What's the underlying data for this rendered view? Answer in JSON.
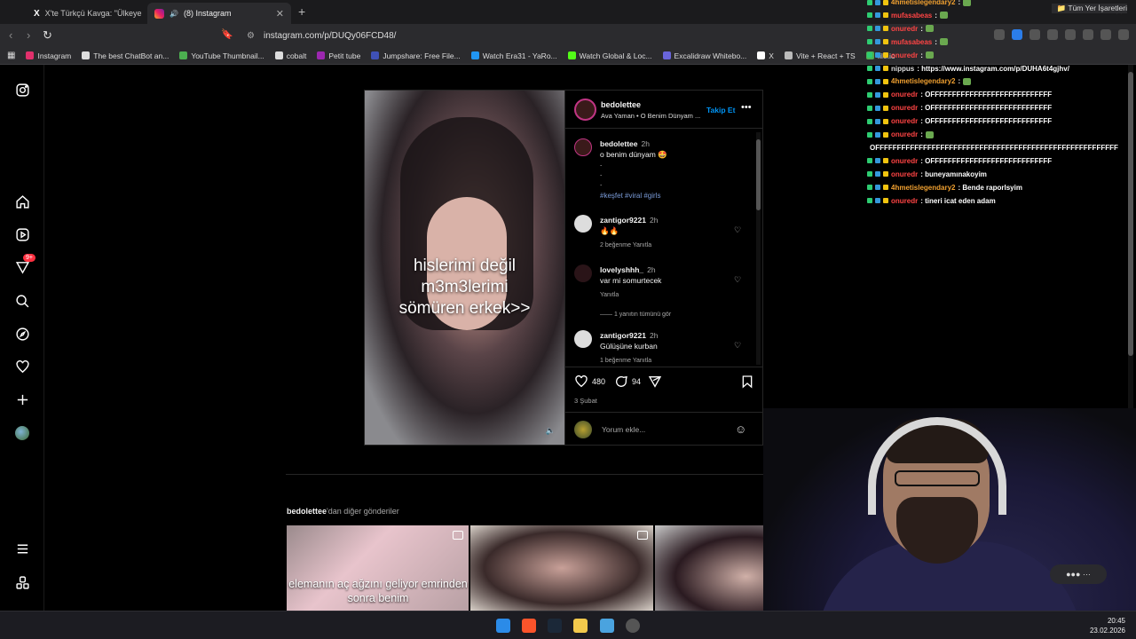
{
  "browser": {
    "tabs": [
      {
        "label": "X'te Türkçü Kavga: \"Ülkeye hiçbir şey",
        "active": false
      },
      {
        "label": "(8) Instagram",
        "active": true
      }
    ],
    "url": "instagram.com/p/DUQy06FCD48/",
    "bookmarks": [
      {
        "label": "Instagram",
        "color": "#e1306c"
      },
      {
        "label": "The best ChatBot an...",
        "color": "#dddddd"
      },
      {
        "label": "YouTube Thumbnail...",
        "color": "#4caf50"
      },
      {
        "label": "cobalt",
        "color": "#dddddd"
      },
      {
        "label": "Petit tube",
        "color": "#9c27b0"
      },
      {
        "label": "Jumpshare: Free File...",
        "color": "#3f51b5"
      },
      {
        "label": "Watch Era31 - YaRo...",
        "color": "#2196f3"
      },
      {
        "label": "Watch Global & Loc...",
        "color": "#53fc18"
      },
      {
        "label": "Excalidraw Whitebo...",
        "color": "#6965db"
      },
      {
        "label": "X",
        "color": "#ffffff"
      },
      {
        "label": "Vite + React + TS",
        "color": "#bbbbbb"
      },
      {
        "label": "file.io",
        "color": "#4caf50"
      }
    ],
    "bookmarks_all": "Tüm Yer İşaretleri"
  },
  "post": {
    "username": "bedolettee",
    "audio": "Ava Yaman • O Benim Dünyam ...",
    "follow_label": "Takip Et",
    "overlay_text": [
      "hislerimi değil",
      "m3m3lerimi",
      "sömüren erkek>>"
    ],
    "caption": {
      "username": "bedolettee",
      "time": "2h",
      "text": "o benim dünyam",
      "dots": [
        ".",
        ".",
        "."
      ],
      "hashtags": "#keşfet #viral #girls"
    },
    "comments": [
      {
        "username": "zantigor9221",
        "time": "2h",
        "text": "🔥🔥",
        "meta": "2 beğenme    Yanıtla"
      },
      {
        "username": "lovelyshhh_",
        "time": "2h",
        "text": "var mi somurtecek",
        "meta": "Yanıtla"
      },
      {
        "username": "zantigor9221",
        "time": "2h",
        "text": "Gülüşüne kurban",
        "meta": "1 beğenme    Yanıtla"
      }
    ],
    "view_replies": "1 yanıtın tümünü gör",
    "likes": "480",
    "comments_count": "94",
    "date": "3 Şubat",
    "add_comment_placeholder": "Yorum ekle..."
  },
  "more_posts": {
    "username": "bedolettee",
    "suffix": "'dan diğer gönderiler",
    "grid_text": "elemanın aç ağzını geliyor emrinden sonra benim"
  },
  "sidebar": {
    "notification_badge": "9+"
  },
  "chat": [
    {
      "user": "4hmetislegendary2",
      "color": "#f0a030",
      "msg": ":"
    },
    {
      "user": "mufasabeas",
      "color": "#ff4444",
      "msg": ":"
    },
    {
      "user": "onuredr",
      "color": "#ff4444",
      "msg": ":"
    },
    {
      "user": "mufasabeas",
      "color": "#ff4444",
      "msg": ":"
    },
    {
      "user": "onuredr",
      "color": "#ff4444",
      "msg": ":"
    },
    {
      "user": "nippus",
      "color": "#dddddd",
      "msg": ": https://www.instagram.com/p/DUHA6t4gjhv/"
    },
    {
      "user": "4hmetislegendary2",
      "color": "#f0a030",
      "msg": ":"
    },
    {
      "user": "onuredr",
      "color": "#ff4444",
      "msg": ": OFFFFFFFFFFFFFFFFFFFFFFFFFFFF"
    },
    {
      "user": "onuredr",
      "color": "#ff4444",
      "msg": ": OFFFFFFFFFFFFFFFFFFFFFFFFFFFF"
    },
    {
      "user": "onuredr",
      "color": "#ff4444",
      "msg": ": OFFFFFFFFFFFFFFFFFFFFFFFFFFFF"
    },
    {
      "user": "onuredr",
      "color": "#ff4444",
      "msg": ":"
    },
    {
      "user": "",
      "color": "#dddddd",
      "msg": "OFFFFFFFFFFFFFFFFFFFFFFFFFFFFFFFFFFFFFFFFFFFFFFFFFFFFFFFF"
    },
    {
      "user": "onuredr",
      "color": "#ff4444",
      "msg": ": OFFFFFFFFFFFFFFFFFFFFFFFFFFFF"
    },
    {
      "user": "onuredr",
      "color": "#ff4444",
      "msg": ": buneyamınakoyim"
    },
    {
      "user": "4hmetislegendary2",
      "color": "#f0a030",
      "msg": ": Bende raporlsyim"
    },
    {
      "user": "onuredr",
      "color": "#ff4444",
      "msg": ": tineri icat eden adam"
    }
  ],
  "taskbar": {
    "time": "20:45",
    "date": "23.02.2026"
  }
}
